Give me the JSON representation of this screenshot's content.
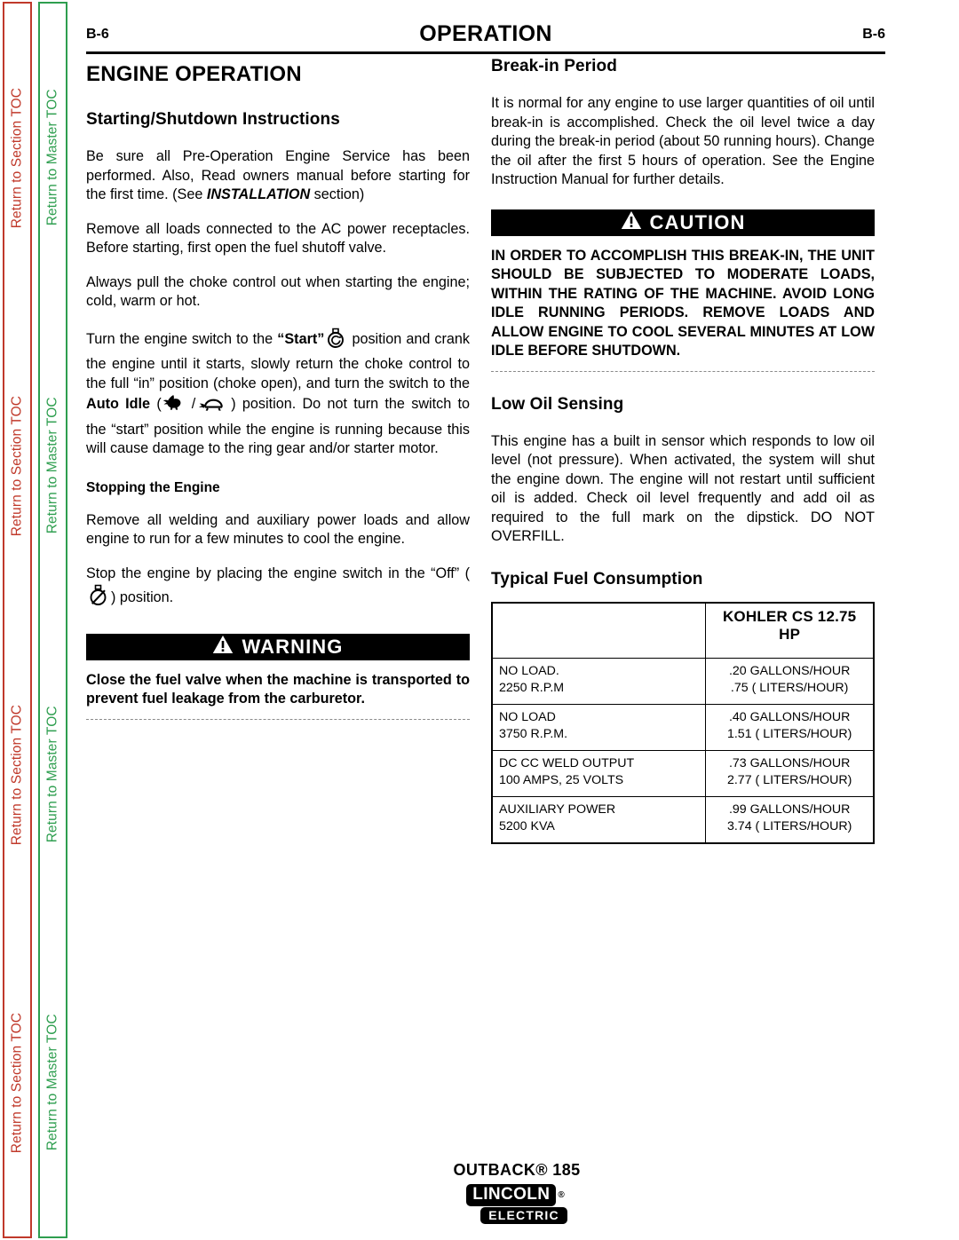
{
  "sidebar": {
    "section_toc_label": "Return to Section TOC",
    "master_toc_label": "Return to Master TOC",
    "section_color": "#C0392B",
    "master_color": "#2E9E4F",
    "repeat_count": 4
  },
  "header": {
    "page_number_left": "B-6",
    "title": "OPERATION",
    "page_number_right": "B-6"
  },
  "left_column": {
    "section_heading": "ENGINE OPERATION",
    "subheading_1": "Starting/Shutdown Instructions",
    "para_1_a": "Be sure all Pre-Operation Engine Service has been performed.  Also, Read owners manual before starting for the first time. (See ",
    "para_1_em": "INSTALLATION",
    "para_1_b": " section)",
    "para_2": "Remove all loads connected to the AC power receptacles. Before starting, first open the fuel shutoff valve.",
    "para_3": "Always pull the choke control out when starting the engine; cold, warm or hot.",
    "para_4_a": "Turn the engine switch to the ",
    "para_4_start_label": "“Start”",
    "para_4_b": " position and crank the engine until it starts, slowly return the choke control to the full “in” position (choke open), and turn the switch to the ",
    "para_4_autoidle_label": "Auto Idle",
    "para_4_c": " (",
    "para_4_slash": "/",
    "para_4_d": ") position. Do not turn the switch to the “start” position while the engine is running because this will cause damage to the ring gear and/or starter motor.",
    "subheading_2": "Stopping the Engine",
    "para_5": "Remove all welding and auxiliary power loads and allow engine to run for a few minutes to cool the engine.",
    "para_6_a": "Stop the engine by placing the engine switch in the “Off” (",
    "para_6_b": ") position.",
    "warning": {
      "banner_label": "WARNING",
      "body": "Close the fuel valve when the machine is transported to prevent fuel leakage from the carburetor."
    }
  },
  "right_column": {
    "subheading_1": "Break-in Period",
    "para_1": "It is normal for any engine to use larger quantities of oil until break-in is accomplished.  Check the oil level twice a day during the break-in period (about 50 running hours).  Change the oil  after the first 5 hours of operation.  See the Engine Instruction Manual for further details.",
    "caution": {
      "banner_label": "CAUTION",
      "body": "IN ORDER TO ACCOMPLISH THIS BREAK-IN, THE UNIT SHOULD   BE SUBJECTED TO MODERATE LOADS, WITHIN THE RATING OF THE MACHINE. AVOID LONG IDLE RUNNING PERIODS.  REMOVE LOADS AND ALLOW ENGINE TO COOL SEVERAL MINUTES AT LOW IDLE BEFORE SHUTDOWN."
    },
    "subheading_2": "Low Oil Sensing",
    "para_2": "This engine has a built in sensor which responds to low oil level (not pressure).  When activated, the system will shut the engine down. The engine will not restart until sufficient oil is added.  Check oil level frequently and add oil as required to the full mark on the dipstick. DO NOT OVERFILL.",
    "subheading_3": "Typical Fuel Consumption",
    "fuel_table": {
      "header_blank": "",
      "header_model": "KOHLER CS 12.75 HP",
      "rows": [
        {
          "label_line1": "NO LOAD.",
          "label_line2": "2250 R.P.M",
          "value_line1": ".20  GALLONS/HOUR",
          "value_line2": ".75 ( LITERS/HOUR)"
        },
        {
          "label_line1": "NO LOAD",
          "label_line2": "3750 R.P.M.",
          "value_line1": ".40  GALLONS/HOUR",
          "value_line2": "1.51 ( LITERS/HOUR)"
        },
        {
          "label_line1": "DC CC WELD OUTPUT",
          "label_line2": "100 AMPS, 25 VOLTS",
          "value_line1": ".73 GALLONS/HOUR",
          "value_line2": "2.77 ( LITERS/HOUR)"
        },
        {
          "label_line1": "AUXILIARY POWER",
          "label_line2": "5200 KVA",
          "value_line1": ".99 GALLONS/HOUR",
          "value_line2": "3.74 ( LITERS/HOUR)"
        }
      ]
    }
  },
  "footer": {
    "model": "OUTBACK® 185",
    "brand_line1": "LINCOLN",
    "brand_reg": "®",
    "brand_line2": "ELECTRIC"
  }
}
